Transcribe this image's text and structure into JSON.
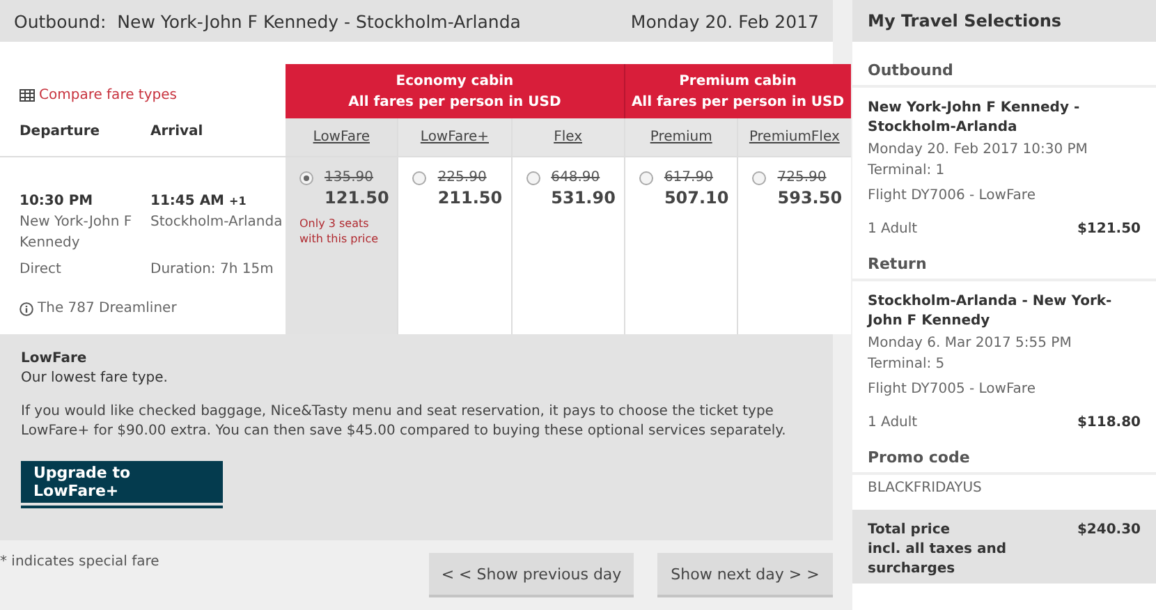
{
  "header": {
    "label": "Outbound:",
    "route": "New York-John F Kennedy - Stockholm-Arlanda",
    "date": "Monday 20. Feb 2017"
  },
  "compare_link": "Compare fare types",
  "columns": {
    "departure": "Departure",
    "arrival": "Arrival"
  },
  "cabins": [
    {
      "title": "Economy cabin",
      "note": "All fares per person in USD",
      "fares": [
        {
          "name": "LowFare",
          "old_price": "135.90",
          "price": "121.50",
          "selected": true,
          "note": "Only 3 seats with this price"
        },
        {
          "name": "LowFare+",
          "old_price": "225.90",
          "price": "211.50",
          "selected": false
        },
        {
          "name": "Flex",
          "old_price": "648.90",
          "price": "531.90",
          "selected": false
        }
      ]
    },
    {
      "title": "Premium cabin",
      "note": "All fares per person in USD",
      "fares": [
        {
          "name": "Premium",
          "old_price": "617.90",
          "price": "507.10",
          "selected": false
        },
        {
          "name": "PremiumFlex",
          "old_price": "725.90",
          "price": "593.50",
          "selected": false
        }
      ]
    }
  ],
  "flight": {
    "departure_time": "10:30 PM",
    "departure_airport": "New York-John F Kennedy",
    "arrival_time": "11:45 AM",
    "day_offset": "+1",
    "arrival_airport": "Stockholm-Arlanda",
    "stops": "Direct",
    "duration": "Duration: 7h 15m",
    "aircraft": "The 787 Dreamliner"
  },
  "info": {
    "title": "LowFare",
    "subtitle": "Our lowest fare type.",
    "body": "If you would like checked baggage, Nice&Tasty menu and seat reservation, it pays to choose the ticket type LowFare+ for $90.00 extra. You can then save $45.00 compared to buying these optional services separately.",
    "button": "Upgrade to LowFare+"
  },
  "footer": {
    "note": "* indicates special fare",
    "previous": "< < Show previous day",
    "next": "Show next day > >"
  },
  "sidebar": {
    "title": "My Travel Selections",
    "segments": [
      {
        "label": "Outbound",
        "route": "New York-John F Kennedy - Stockholm-Arlanda",
        "datetime": "Monday 20. Feb 2017 10:30 PM",
        "terminal": "Terminal: 1",
        "flight": "Flight DY7006 - LowFare",
        "passengers": "1 Adult",
        "price": "$121.50"
      },
      {
        "label": "Return",
        "route": "Stockholm-Arlanda - New York-John F Kennedy",
        "datetime": "Monday 6. Mar 2017 5:55 PM",
        "terminal": "Terminal: 5",
        "flight": "Flight DY7005 - LowFare",
        "passengers": "1 Adult",
        "price": "$118.80"
      }
    ],
    "promo": {
      "label": "Promo code",
      "code": "BLACKFRIDAYUS"
    },
    "total": {
      "label": "Total price",
      "note": "incl. all taxes and surcharges",
      "price": "$240.30"
    }
  }
}
